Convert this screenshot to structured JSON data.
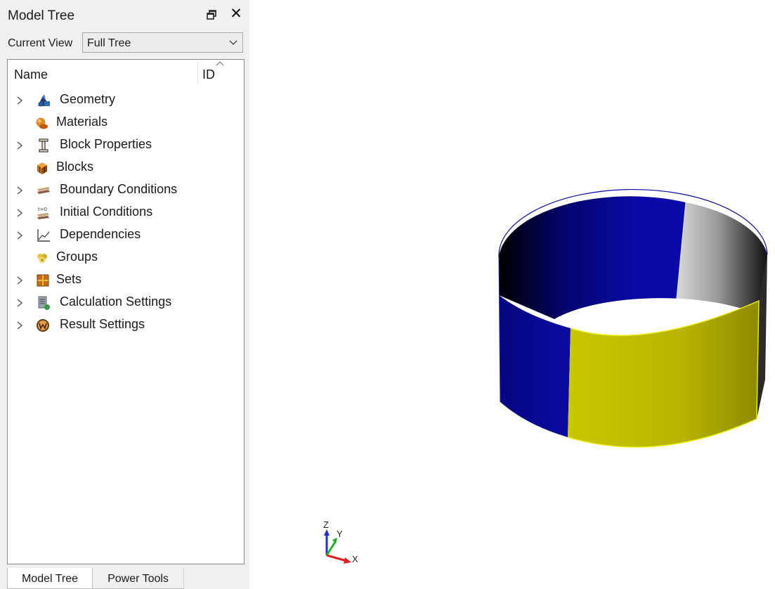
{
  "panel": {
    "title": "Model Tree",
    "current_view_label": "Current View",
    "current_view_value": "Full Tree",
    "columns": {
      "name": "Name",
      "id": "ID"
    },
    "tree_items": [
      {
        "label": "Geometry",
        "icon": "geometry-icon",
        "expandable": true
      },
      {
        "label": "Materials",
        "icon": "materials-icon",
        "expandable": false
      },
      {
        "label": "Block Properties",
        "icon": "block-properties-icon",
        "expandable": true
      },
      {
        "label": "Blocks",
        "icon": "blocks-icon",
        "expandable": false
      },
      {
        "label": "Boundary Conditions",
        "icon": "boundary-conditions-icon",
        "expandable": true
      },
      {
        "label": "Initial Conditions",
        "icon": "initial-conditions-icon",
        "expandable": true
      },
      {
        "label": "Dependencies",
        "icon": "dependencies-icon",
        "expandable": true
      },
      {
        "label": "Groups",
        "icon": "groups-icon",
        "expandable": false
      },
      {
        "label": "Sets",
        "icon": "sets-icon",
        "expandable": true
      },
      {
        "label": "Calculation Settings",
        "icon": "calculation-settings-icon",
        "expandable": true
      },
      {
        "label": "Result Settings",
        "icon": "result-settings-icon",
        "expandable": true
      }
    ],
    "tabs": [
      {
        "label": "Model Tree",
        "active": true
      },
      {
        "label": "Power Tools",
        "active": false
      }
    ]
  },
  "viewport": {
    "axis_labels": {
      "x": "X",
      "y": "Y",
      "z": "Z"
    },
    "model_colors": {
      "blue": "#0a0a9a",
      "yellow": "#cccc00",
      "grey": "#9e9e9e"
    },
    "axis_colors": {
      "x": "#e02020",
      "y": "#20b020",
      "z": "#2030d0"
    }
  }
}
